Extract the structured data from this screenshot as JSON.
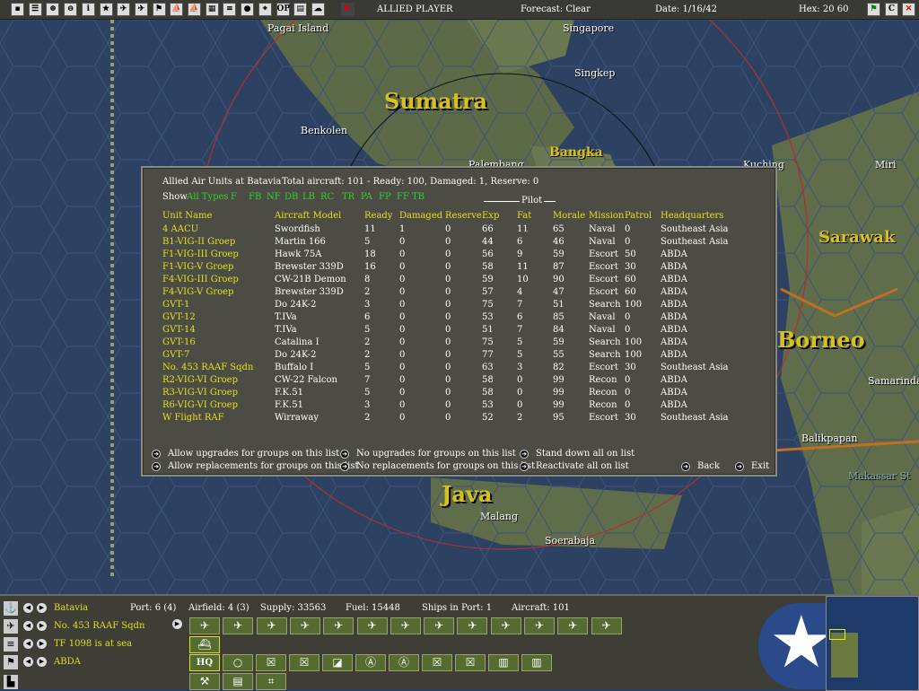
{
  "topbar": {
    "player": "ALLIED PLAYER",
    "forecast": "Forecast: Clear",
    "date": "Date: 1/16/42",
    "hex": "Hex: 20 60",
    "buttons": [
      "save-icon",
      "list-icon",
      "target-icon",
      "target2-icon",
      "info-icon",
      "star-icon",
      "red-plane-icon",
      "blue-plane-icon",
      "flag-icon",
      "ship-icon",
      "ship2-icon",
      "grid-icon",
      "base-icon",
      "globe-icon",
      "crosshair-icon",
      "op-icon",
      "report-icon",
      "weather-icon"
    ],
    "op_label": "OP",
    "info_label": "i",
    "c_label": "C"
  },
  "map": {
    "labels": [
      "Pagai Island",
      "Singapore",
      "Singkep",
      "Benkolen",
      "Palembang",
      "Kuching",
      "Miri",
      "Samarinda",
      "Balikpapan",
      "Makassar St",
      "Malang",
      "Soerabaja"
    ],
    "regions": [
      "Sumatra",
      "Sarawak",
      "Borneo",
      "Java",
      "Bangka"
    ]
  },
  "dialog": {
    "title": "Allied Air Units at Batavia",
    "summary": "Total aircraft: 101 - Ready: 100, Damaged: 1, Reserve: 0",
    "show_label": "Show",
    "filters": [
      "All Types",
      "F",
      "FB",
      "NF",
      "DB",
      "LB",
      "RC",
      "TR",
      "PA",
      "FP",
      "FF",
      "TB"
    ],
    "pilot_label": "Pilot",
    "columns": [
      "Unit Name",
      "Aircraft Model",
      "Ready",
      "Damaged",
      "Reserve",
      "Exp",
      "Fat",
      "Morale",
      "Mission",
      "Patrol",
      "Headquarters"
    ],
    "rows": [
      [
        "4 AACU",
        "Swordfish",
        "11",
        "1",
        "0",
        "66",
        "11",
        "65",
        "Naval",
        "0",
        "Southeast Asia"
      ],
      [
        "B1-VIG-II Groep",
        "Martin 166",
        "5",
        "0",
        "0",
        "44",
        "6",
        "46",
        "Naval",
        "0",
        "Southeast Asia"
      ],
      [
        "F1-VIG-III Groep",
        "Hawk 75A",
        "18",
        "0",
        "0",
        "56",
        "9",
        "59",
        "Escort",
        "50",
        "ABDA"
      ],
      [
        "F1-VIG-V Groep",
        "Brewster 339D",
        "16",
        "0",
        "0",
        "58",
        "11",
        "87",
        "Escort",
        "30",
        "ABDA"
      ],
      [
        "F4-VIG-III Groep",
        "CW-21B Demon",
        "8",
        "0",
        "0",
        "59",
        "10",
        "90",
        "Escort",
        "60",
        "ABDA"
      ],
      [
        "F4-VIG-V Groep",
        "Brewster 339D",
        "2",
        "0",
        "0",
        "57",
        "4",
        "47",
        "Escort",
        "60",
        "ABDA"
      ],
      [
        "GVT-1",
        "Do 24K-2",
        "3",
        "0",
        "0",
        "75",
        "7",
        "51",
        "Search",
        "100",
        "ABDA"
      ],
      [
        "GVT-12",
        "T.IVa",
        "6",
        "0",
        "0",
        "53",
        "6",
        "85",
        "Naval",
        "0",
        "ABDA"
      ],
      [
        "GVT-14",
        "T.IVa",
        "5",
        "0",
        "0",
        "51",
        "7",
        "84",
        "Naval",
        "0",
        "ABDA"
      ],
      [
        "GVT-16",
        "Catalina I",
        "2",
        "0",
        "0",
        "75",
        "5",
        "59",
        "Search",
        "100",
        "ABDA"
      ],
      [
        "GVT-7",
        "Do 24K-2",
        "2",
        "0",
        "0",
        "77",
        "5",
        "55",
        "Search",
        "100",
        "ABDA"
      ],
      [
        "No. 453 RAAF Sqdn",
        "Buffalo I",
        "5",
        "0",
        "0",
        "63",
        "3",
        "82",
        "Escort",
        "30",
        "Southeast Asia"
      ],
      [
        "R2-VIG-VI Groep",
        "CW-22 Falcon",
        "7",
        "0",
        "0",
        "58",
        "0",
        "99",
        "Recon",
        "0",
        "ABDA"
      ],
      [
        "R3-VIG-VI Groep",
        "F.K.51",
        "5",
        "0",
        "0",
        "58",
        "0",
        "99",
        "Recon",
        "0",
        "ABDA"
      ],
      [
        "R6-VIG-VI Groep",
        "F.K.51",
        "3",
        "0",
        "0",
        "53",
        "0",
        "99",
        "Recon",
        "0",
        "ABDA"
      ],
      [
        "W Flight RAF",
        "Wirraway",
        "2",
        "0",
        "0",
        "52",
        "2",
        "95",
        "Escort",
        "30",
        "Southeast Asia"
      ]
    ],
    "actions": [
      "Allow upgrades for groups on this list",
      "Allow replacements for groups on this list",
      "No upgrades for groups on this list",
      "No replacements for groups on this list",
      "Stand down all on list",
      "Reactivate all on list",
      "Back",
      "Exit"
    ]
  },
  "bottom": {
    "base": "Batavia",
    "port": "Port: 6 (4)",
    "airfield": "Airfield: 4 (3)",
    "supply": "Supply: 33563",
    "fuel": "Fuel: 15448",
    "ships": "Ships in Port: 1",
    "aircraft": "Aircraft: 101",
    "air_unit": "No. 453 RAAF Sqdn",
    "task_force": "TF 1098 is at sea",
    "hq": "ABDA",
    "hq_label": "HQ"
  },
  "colors": {
    "accent_yellow": "#e0e020",
    "filter_green": "#30d030",
    "panel": "#4d4c44"
  }
}
